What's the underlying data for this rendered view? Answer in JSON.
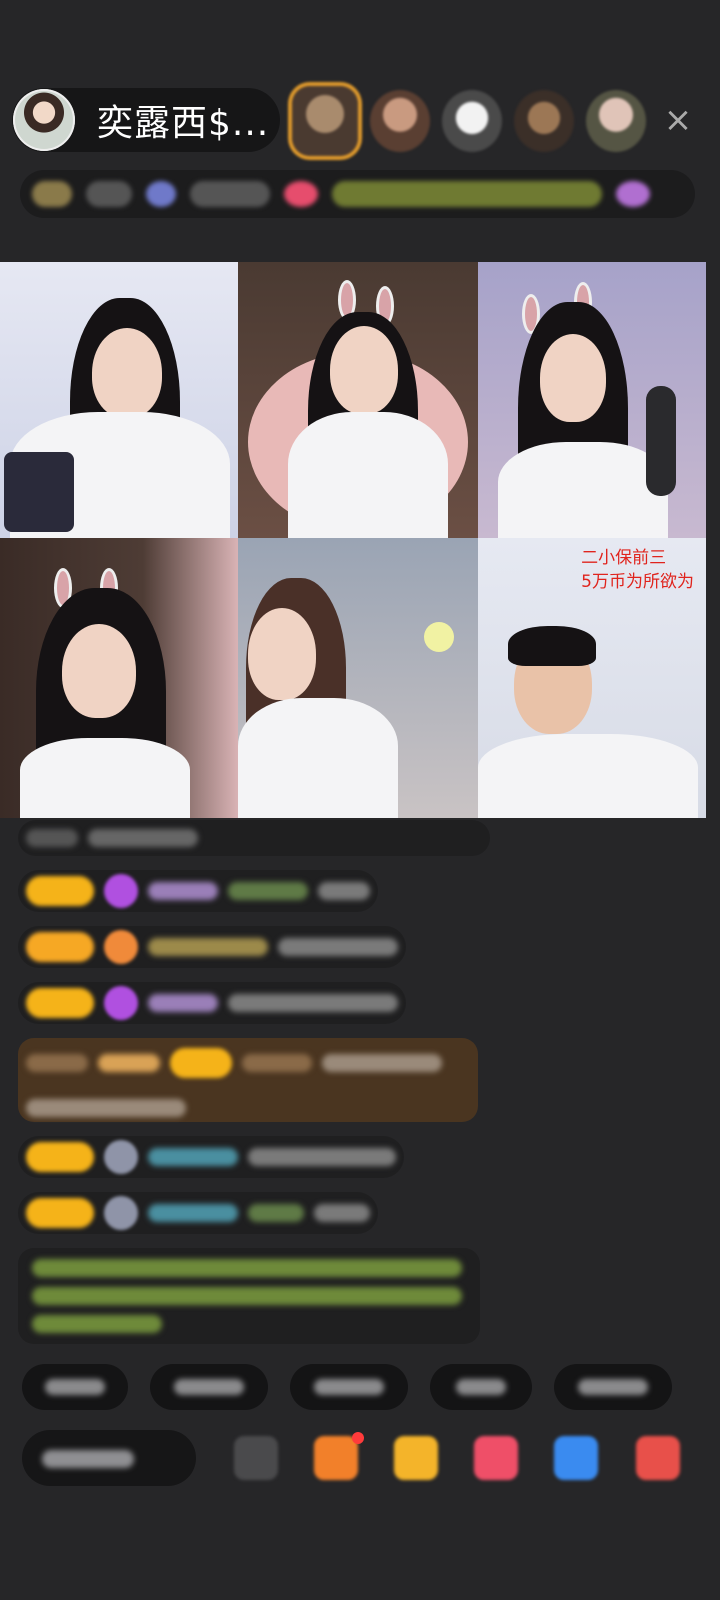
{
  "header": {
    "host_name": "奕露西$...",
    "close_icon": "×"
  },
  "video_grid": {
    "promo_line1": "二小保前三",
    "promo_line2": "5万币为所欲为"
  },
  "colors": {
    "background": "#262628",
    "badge_gold": "#f5b319",
    "promo_red": "#e0241d",
    "frame_orange": "#e09a2c"
  },
  "icons": {
    "close": "close-icon",
    "gift": "gift-icon",
    "more": "more-icon"
  }
}
